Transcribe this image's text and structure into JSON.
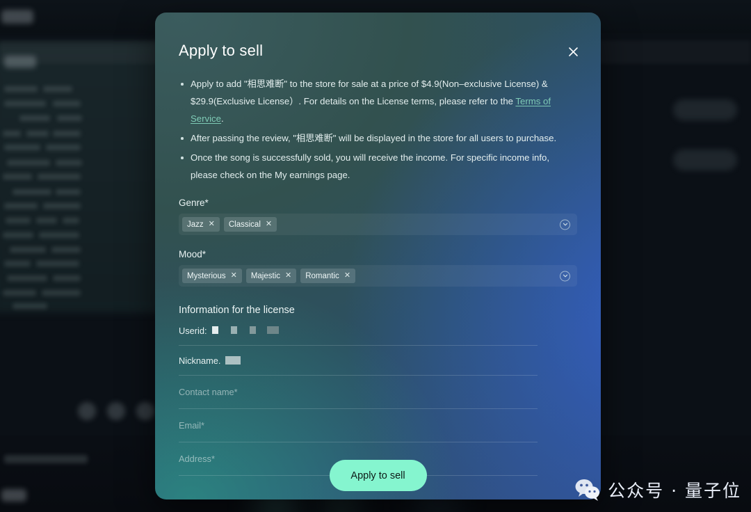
{
  "modal": {
    "title": "Apply to sell",
    "close_icon": "close-icon",
    "bullets": [
      {
        "text_before": "Apply to add \"相思难断\" to the store for sale at a price of $4.9(Non–exclusive License) & $29.9(Exclusive License）. For details on the License terms, please refer to the ",
        "link_text": "Terms of Service",
        "text_after": "."
      },
      {
        "text_before": "After passing the review, \"相思难断\" will be displayed in the store for all users to purchase.",
        "link_text": "",
        "text_after": ""
      },
      {
        "text_before": "Once the song is successfully sold, you will receive the income. For specific income info, please check on the My earnings page.",
        "link_text": "",
        "text_after": ""
      }
    ],
    "genre": {
      "label": "Genre*",
      "tags": [
        "Jazz",
        "Classical"
      ],
      "remove_glyph": "✕",
      "caret_icon": "chevron-down-circle-icon"
    },
    "mood": {
      "label": "Mood*",
      "tags": [
        "Mysterious",
        "Majestic",
        "Romantic"
      ],
      "remove_glyph": "✕",
      "caret_icon": "chevron-down-circle-icon"
    },
    "license": {
      "section_title": "Information for the license",
      "userid_label": "Userid:",
      "userid_value": "",
      "nickname_label": "Nickname.",
      "nickname_value": ""
    },
    "inputs": [
      {
        "name": "contact-name",
        "placeholder": "Contact name*",
        "value": ""
      },
      {
        "name": "email",
        "placeholder": "Email*",
        "value": ""
      },
      {
        "name": "address",
        "placeholder": "Address*",
        "value": ""
      }
    ],
    "submit_label": "Apply to sell"
  },
  "watermark": {
    "text": "公众号 · 量子位",
    "icon": "wechat-icon"
  },
  "colors": {
    "accent_button": "#85f5cf",
    "link": "#7fcbb6",
    "modal_text": "#e3eeee",
    "backdrop": "#0b1016"
  }
}
